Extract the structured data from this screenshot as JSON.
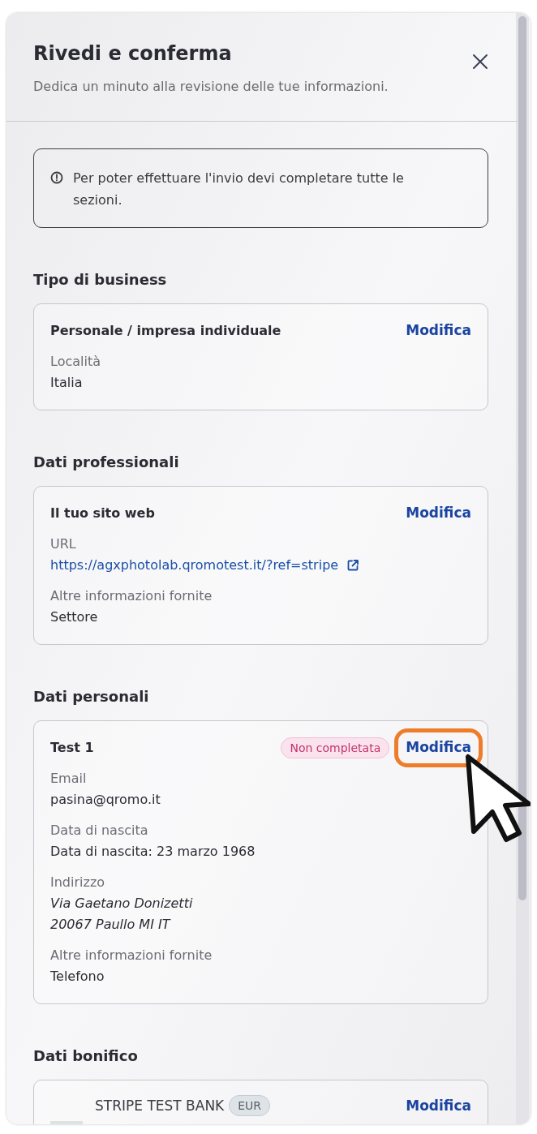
{
  "header": {
    "title": "Rivedi e conferma",
    "subtitle": "Dedica un minuto alla revisione delle tue informazioni."
  },
  "alert": {
    "text": "Per poter effettuare l'invio devi completare tutte le sezioni."
  },
  "sections": [
    {
      "heading": "Tipo di business",
      "card": {
        "kind": "details",
        "title": "Personale / impresa individuale",
        "edit": "Modifica",
        "highlighted": false,
        "fields": [
          {
            "label": "Località",
            "kind": "text",
            "lines": [
              "Italia"
            ]
          }
        ]
      }
    },
    {
      "heading": "Dati professionali",
      "card": {
        "kind": "details",
        "title": "Il tuo sito web",
        "edit": "Modifica",
        "highlighted": false,
        "fields": [
          {
            "label": "URL",
            "kind": "link",
            "lines": [
              "https://agxphotolab.qromotest.it/?ref=stripe"
            ]
          },
          {
            "label": "Altre informazioni fornite",
            "kind": "text",
            "lines": [
              "Settore"
            ]
          }
        ]
      }
    },
    {
      "heading": "Dati personali",
      "card": {
        "kind": "details",
        "title": "Test 1",
        "badge": "Non completata",
        "edit": "Modifica",
        "highlighted": true,
        "fields": [
          {
            "label": "Email",
            "kind": "text",
            "lines": [
              "pasina@qromo.it"
            ]
          },
          {
            "label": "Data di nascita",
            "kind": "text",
            "lines": [
              "Data di nascita: 23 marzo 1968"
            ]
          },
          {
            "label": "Indirizzo",
            "kind": "italic",
            "lines": [
              "Via Gaetano Donizetti",
              "20067 Paullo MI IT"
            ]
          },
          {
            "label": "Altre informazioni fornite",
            "kind": "text",
            "lines": [
              "Telefono"
            ]
          }
        ]
      }
    },
    {
      "heading": "Dati bonifico",
      "card": {
        "kind": "bank",
        "title": "STRIPE TEST BANK",
        "badge": "EUR",
        "edit": "Modifica",
        "highlighted": false
      }
    }
  ]
}
